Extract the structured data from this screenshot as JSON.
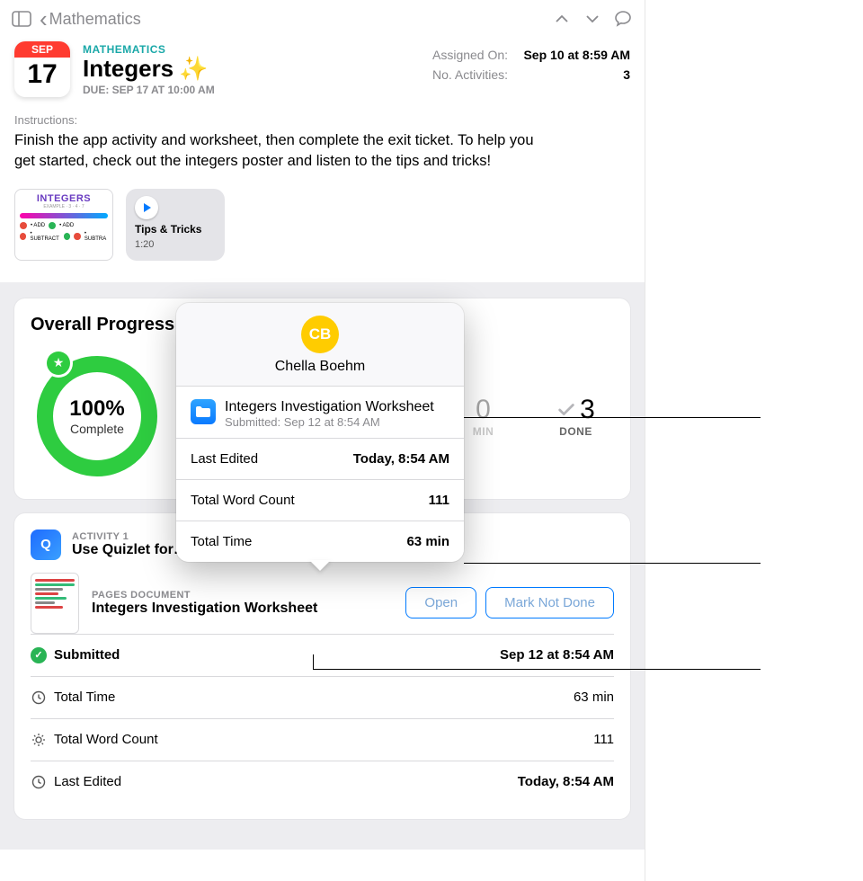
{
  "nav": {
    "back_label": "Mathematics"
  },
  "header": {
    "calendar_month": "SEP",
    "calendar_day": "17",
    "category": "MATHEMATICS",
    "title": "Integers",
    "sparkle": "✨",
    "due": "DUE: SEP 17 AT 10:00 AM",
    "meta": {
      "assigned_label": "Assigned On:",
      "assigned_value": "Sep 10 at 8:59 AM",
      "activities_label": "No. Activities:",
      "activities_value": "3"
    }
  },
  "instructions": {
    "label": "Instructions:",
    "text": "Finish the app activity and worksheet, then complete the exit ticket. To help you get started, check out the integers poster and listen to the tips and tricks!"
  },
  "attachments": {
    "poster_title": "INTEGERS",
    "tips_title": "Tips & Tricks",
    "tips_duration": "1:20"
  },
  "progress": {
    "heading": "Overall Progress",
    "percent": "100%",
    "percent_label": "Complete",
    "stats": {
      "min_value": "0",
      "min_label": "MIN",
      "done_value": "3",
      "done_label": "DONE"
    }
  },
  "activity": {
    "eyebrow": "ACTIVITY 1",
    "title": "Use Quizlet for…",
    "doc_eyebrow": "PAGES DOCUMENT",
    "doc_title": "Integers Investigation Worksheet",
    "open_label": "Open",
    "mark_label": "Mark Not Done",
    "rows": {
      "submitted_label": "Submitted",
      "submitted_value": "Sep 12 at 8:54 AM",
      "time_label": "Total Time",
      "time_value": "63 min",
      "words_label": "Total Word Count",
      "words_value": "111",
      "edited_label": "Last Edited",
      "edited_value": "Today, 8:54 AM"
    }
  },
  "popover": {
    "initials": "CB",
    "name": "Chella Boehm",
    "file_title": "Integers Investigation Worksheet",
    "file_submitted": "Submitted: Sep 12 at 8:54 AM",
    "rows": {
      "edited_label": "Last Edited",
      "edited_value": "Today, 8:54 AM",
      "words_label": "Total Word Count",
      "words_value": "111",
      "time_label": "Total Time",
      "time_value": "63 min"
    }
  }
}
